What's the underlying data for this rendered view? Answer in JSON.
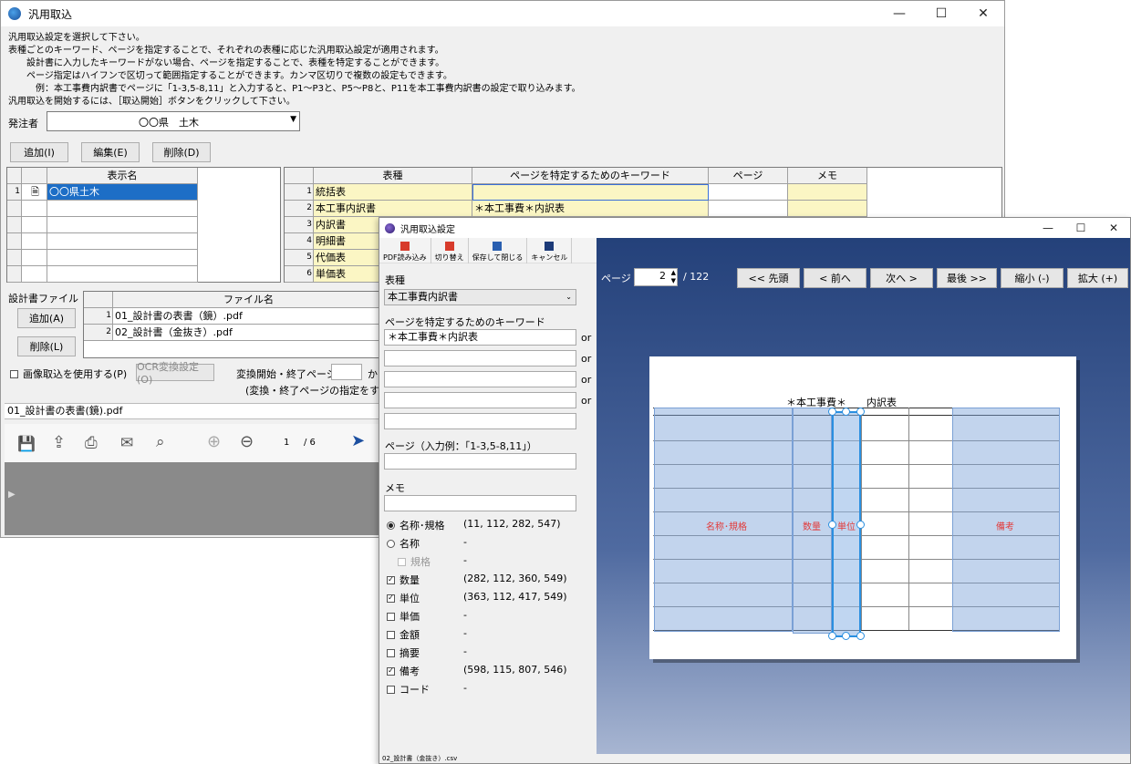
{
  "win1": {
    "title": "汎用取込",
    "controls": {
      "minimize": "—",
      "maximize": "☐",
      "close": "✕"
    },
    "instructions": "汎用取込設定を選択して下さい。\n表種ごとのキーワード、ページを指定することで、それぞれの表種に応じた汎用取込設定が適用されます。\n　　設計書に入力したキーワードがない場合、ページを指定することで、表種を特定することができます。\n　　ページ指定はハイフンで区切って範囲指定することができます。カンマ区切りで複数の設定もできます。\n　　　例：本工事費内訳書でページに「1-3,5-8,11」と入力すると、P1～P3と、P5～P8と、P11を本工事費内訳書の設定で取り込みます。\n汎用取込を開始するには、［取込開始］ボタンをクリックして下さい。",
    "orderer_label": "発注者",
    "orderer_value": "〇〇県　土木",
    "buttons": {
      "add": "追加(I)",
      "edit": "編集(E)",
      "delete": "削除(D)"
    },
    "left_grid": {
      "header": "表示名",
      "rows": [
        {
          "num": "1",
          "name": "〇〇県土木"
        }
      ]
    },
    "right_grid": {
      "headers": [
        "表種",
        "ページを特定するためのキーワード",
        "ページ",
        "メモ"
      ],
      "rows": [
        {
          "num": "1",
          "type": "統括表",
          "keyword": ""
        },
        {
          "num": "2",
          "type": "本工事内訳書",
          "keyword": "＊本工事費＊内訳表"
        },
        {
          "num": "3",
          "type": "内訳書",
          "keyword": ""
        },
        {
          "num": "4",
          "type": "明細書",
          "keyword": ""
        },
        {
          "num": "5",
          "type": "代価表",
          "keyword": ""
        },
        {
          "num": "6",
          "type": "単価表",
          "keyword": ""
        }
      ]
    },
    "design_files_label": "設計書ファイル",
    "file_header": "ファイル名",
    "files": [
      {
        "num": "1",
        "name": "01_設計書の表書（鏡）.pdf"
      },
      {
        "num": "2",
        "name": "02_設計書（金抜き）.pdf"
      }
    ],
    "file_buttons": {
      "add": "追加(A)",
      "delete": "削除(L)"
    },
    "image_import_label": "画像取込を使用する(P)",
    "ocr_button": "OCR変換設定(O)",
    "convert_label": "変換開始・終了ページ",
    "convert_from": "か",
    "convert_note": "(変換・終了ページの指定をすると",
    "current_file": "01_設計書の表書(鏡).pdf",
    "viewer": {
      "page": "1",
      "total": "/ 6"
    }
  },
  "win2": {
    "title": "汎用取込設定",
    "toolbar": {
      "pdf_read": "PDF読み込み",
      "switch": "切り替え",
      "save_close": "保存して閉じる",
      "cancel": "キャンセル"
    },
    "type_label": "表種",
    "type_value": "本工事費内訳書",
    "keyword_label": "ページを特定するためのキーワード",
    "keywords": [
      "＊本工事費＊内訳表",
      "",
      "",
      "",
      ""
    ],
    "or_text": "or",
    "page_label": "ページ（入力例：「1-3,5-8,11」）",
    "memo_label": "メモ",
    "fields": [
      {
        "label": "名称･規格",
        "kind": "radio",
        "checked": true,
        "coords": "(11, 112, 282, 547)"
      },
      {
        "label": "名称",
        "kind": "radio",
        "checked": false,
        "coords": "-"
      },
      {
        "label": "規格",
        "kind": "check-disabled",
        "checked": false,
        "coords": "-"
      },
      {
        "label": "数量",
        "kind": "check",
        "checked": true,
        "coords": "(282, 112, 360, 549)"
      },
      {
        "label": "単位",
        "kind": "check",
        "checked": true,
        "coords": "(363, 112, 417, 549)"
      },
      {
        "label": "単価",
        "kind": "check",
        "checked": false,
        "coords": "-"
      },
      {
        "label": "金額",
        "kind": "check",
        "checked": false,
        "coords": "-"
      },
      {
        "label": "摘要",
        "kind": "check",
        "checked": false,
        "coords": "-"
      },
      {
        "label": "備考",
        "kind": "check",
        "checked": true,
        "coords": "(598, 115, 807, 546)"
      },
      {
        "label": "コード",
        "kind": "check",
        "checked": false,
        "coords": "-"
      }
    ],
    "nav": {
      "page_label": "ページ",
      "page": "2",
      "total": "/ 122",
      "first": "<< 先頭",
      "prev": "< 前へ",
      "next": "次へ >",
      "last": "最後 >>",
      "zoom_out": "縮小 (-)",
      "zoom_in": "拡大 (+)"
    },
    "doc": {
      "title": "＊本工事費＊　　内訳表",
      "labels": {
        "name": "名称･規格",
        "qty": "数量",
        "unit": "単位",
        "remarks": "備考"
      }
    },
    "status": "02_設計書（金抜き）.csv"
  }
}
